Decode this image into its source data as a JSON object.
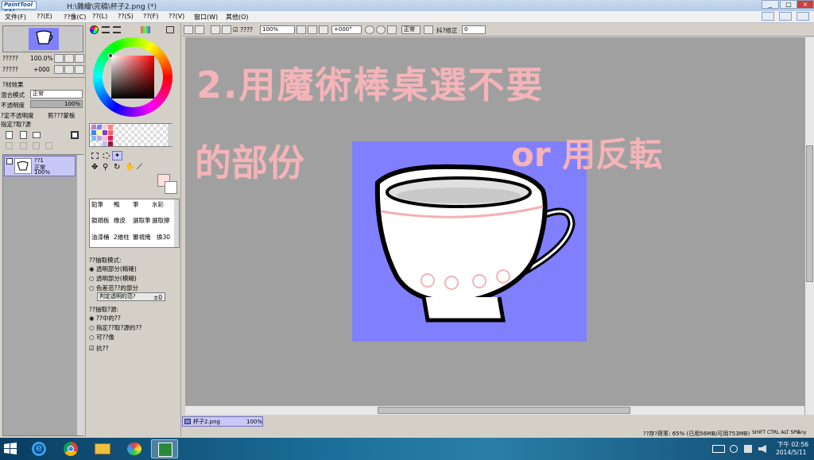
{
  "window": {
    "logo": "PaintTool SAI",
    "title": "H:\\雜繪\\完稿\\杯子2.png (*)",
    "min": "_",
    "max": "□",
    "close": "×"
  },
  "menu": [
    {
      "label": "文件(F)"
    },
    {
      "label": "??(E)"
    },
    {
      "label": "??像(C)"
    },
    {
      "label": "??(L)"
    },
    {
      "label": "??(S)"
    },
    {
      "label": "??(F)"
    },
    {
      "label": "??(V)"
    },
    {
      "label": "窗口(W)"
    },
    {
      "label": "其他(O)"
    }
  ],
  "navigator": {
    "zoom_label": "?????",
    "zoom_value": "100.0%",
    "angle_label": "?????",
    "angle_value": "+000"
  },
  "layers": {
    "fx_label": "?材效果",
    "blend_label": "混合模式",
    "blend_value": "正常",
    "opacity_label": "不透明度",
    "opacity_value": "100%",
    "preserve_label": "?定不透明度",
    "clip_label": "剪???蒙板",
    "source_label": "指定?取?源",
    "layer_name": "??1",
    "layer_mode": "正常",
    "layer_opacity": "100%"
  },
  "tools": [
    "鉛筆",
    "鴨",
    "筆",
    "水彩",
    "鎖頭板",
    "橡皮",
    "選取筆",
    "選取擦",
    "油漆桶",
    "2維柱",
    "審視掩",
    "換30"
  ],
  "options": {
    "mode_title": "??抽取模式:",
    "mode1": "透明部分(精確)",
    "mode2": "透明部分(模糊)",
    "mode3": "色差范??的部分",
    "transparency_label": "判定透明的范?",
    "transparency_value": "±0",
    "source_title": "??抽取?源:",
    "src1": "??中的??",
    "src2": "指定??取?源的??",
    "src3": "可??像",
    "aa_label": "抗??"
  },
  "toolbar": {
    "checkbox_label": "????",
    "zoom": "100%",
    "angle": "+000°",
    "blend": "正常",
    "stab_label": "抖?修正",
    "stab_value": "0"
  },
  "canvas": {
    "annotation_line1": "2.用魔術棒桌選不要",
    "annotation_line2": "的部份",
    "annotation_line3": "or 用反転"
  },
  "tab": {
    "name": "杯子2.png",
    "zoom": "100%"
  },
  "status": {
    "memory": "??存?荷率: 65% (已用56MB/可用753MB)",
    "keys": "SHIFT CTRL ALT SPC",
    "any": "Any"
  },
  "taskbar": {
    "time": "下午 02:56",
    "date": "2014/5/11"
  },
  "colors": {
    "canvas_bg": "#8080ff",
    "accent": "#c8c8f8",
    "annotation": "#f4b4b8"
  },
  "icons": [
    "windows-start-icon",
    "ie-icon",
    "chrome-icon",
    "folder-icon",
    "paint-icon",
    "sai-icon"
  ]
}
